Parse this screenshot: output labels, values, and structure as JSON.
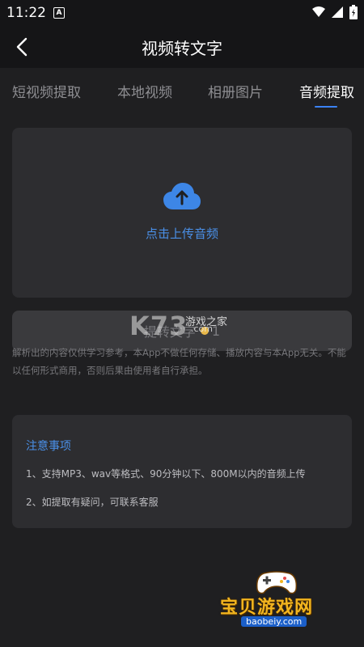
{
  "status_bar": {
    "time": "11:22",
    "notification_letter": "A",
    "icons": [
      "wifi-icon",
      "signal-icon",
      "battery-icon"
    ]
  },
  "header": {
    "title": "视频转文字",
    "back_icon": "chevron-left-icon"
  },
  "tabs": [
    {
      "label": "短视频提取",
      "active": false
    },
    {
      "label": "本地视频",
      "active": false
    },
    {
      "label": "相册图片",
      "active": false
    },
    {
      "label": "音频提取",
      "active": true
    }
  ],
  "upload": {
    "label": "点击上传音频",
    "icon": "cloud-upload-icon"
  },
  "convert": {
    "label": "提转文字",
    "cost": "1"
  },
  "watermark": {
    "brand": "K73",
    "sub": "游戏之家",
    "domain": ".com"
  },
  "disclaimer": "解析出的内容仅供学习参考，本App不做任何存储、播放内容与本App无关。不能以任何形式商用，否则后果由使用者自行承担。",
  "notes": {
    "title": "注意事项",
    "items": [
      "1、支持MP3、wav等格式、90分钟以下、800M以内的音频上传",
      "2、如提取有疑问，可联系客服"
    ]
  },
  "bottom_watermark": {
    "title": "宝贝游戏网",
    "url": "baobeiy.com"
  },
  "colors": {
    "background": "#1f1f21",
    "card": "#2d2d30",
    "accent": "#4a90e8",
    "tab_indicator": "#3b82f6"
  }
}
